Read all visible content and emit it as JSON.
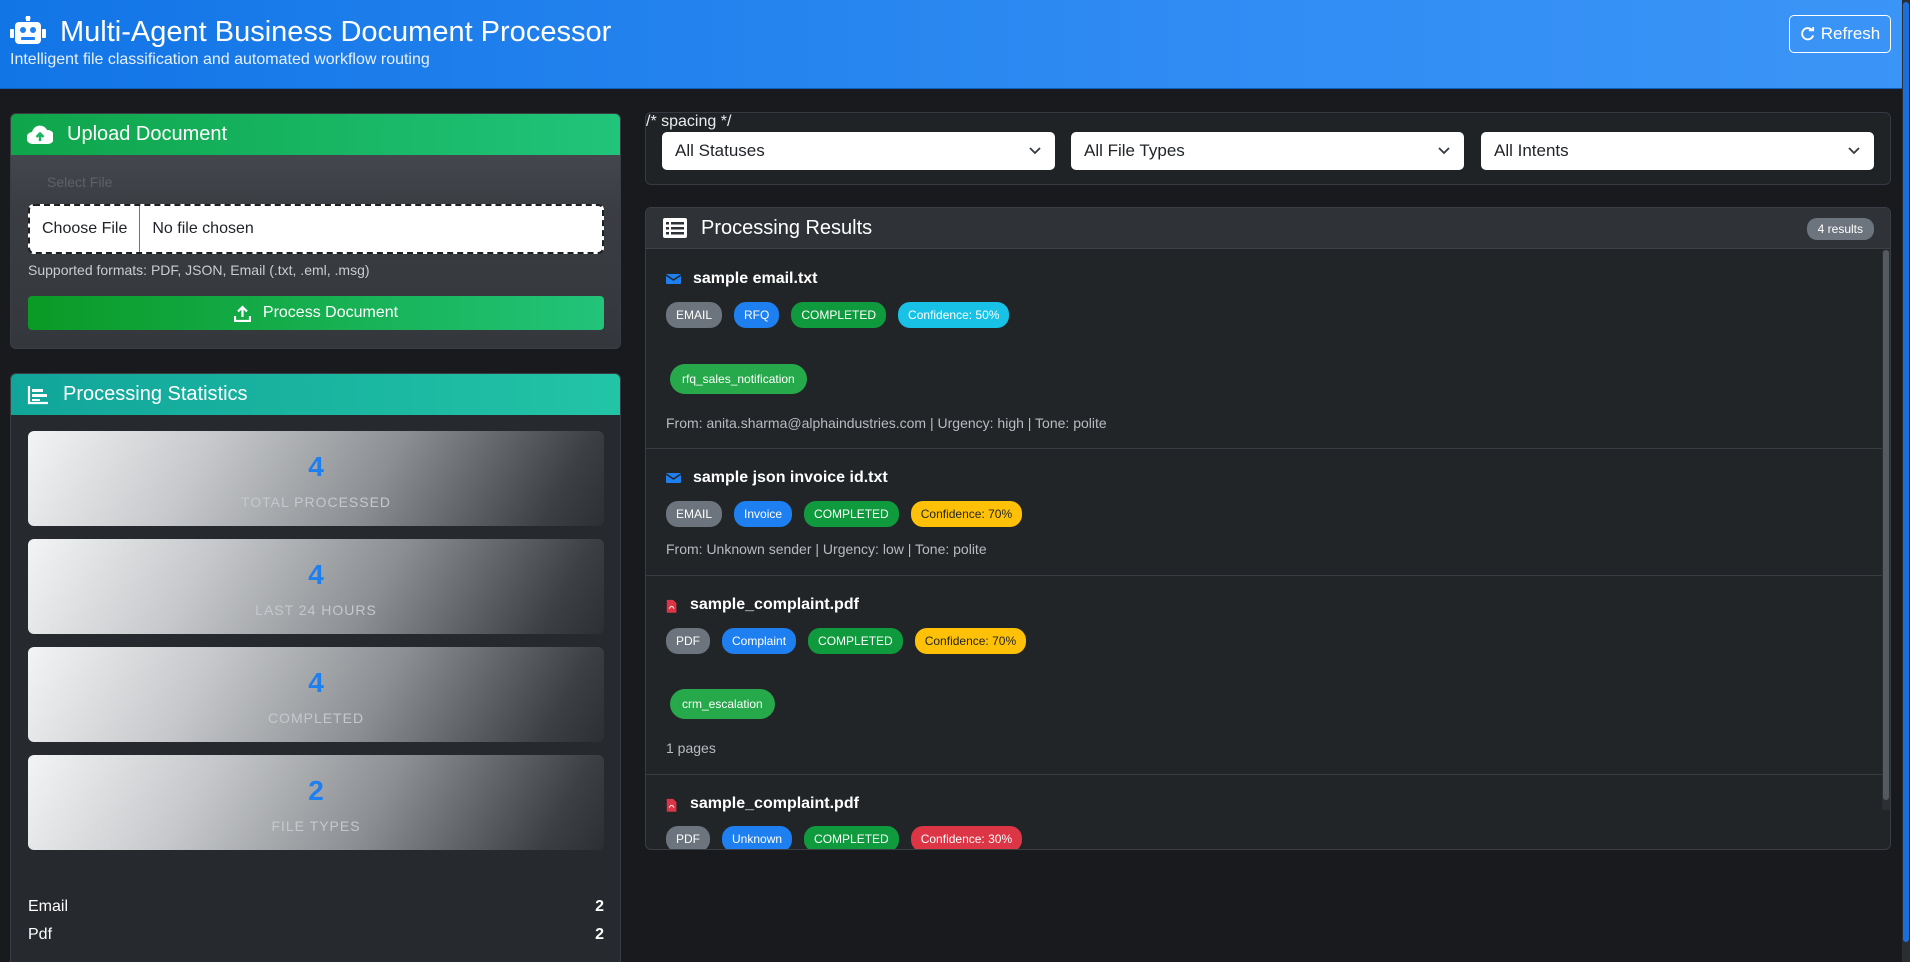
{
  "header": {
    "title": "Multi-Agent Business Document Processor",
    "subtitle": "Intelligent file classification and automated workflow routing",
    "refresh_label": "Refresh",
    "icon": "robot-icon"
  },
  "upload": {
    "title": "Upload Document",
    "choose_label": "Select File",
    "file_button": "Choose File",
    "file_status": "No file chosen",
    "formats": "Supported formats: PDF, JSON, Email (.txt, .eml, .msg)",
    "process_label": "Process Document"
  },
  "stats": {
    "title": "Processing Statistics",
    "boxes": [
      {
        "value": "4",
        "label": "Total Processed"
      },
      {
        "value": "4",
        "label": "Last 24 Hours"
      },
      {
        "value": "4",
        "label": "Completed"
      },
      {
        "value": "2",
        "label": "File Types"
      }
    ],
    "types": [
      {
        "name": "Email",
        "count": "2"
      },
      {
        "name": "Pdf",
        "count": "2"
      }
    ]
  },
  "filters": {
    "status": "All Statuses",
    "file_type": "All File Types",
    "intent": "All Intents"
  },
  "results": {
    "title": "Processing Results",
    "count": "4 results",
    "items": [
      {
        "name": "sample email.txt",
        "icon": "envelope-icon",
        "badges": [
          "EMAIL",
          "RFQ",
          "COMPLETED",
          "Confidence: 50%"
        ],
        "route": "rfq_sales_notification",
        "meta": "From: anita.sharma@alphaindustries.com | Urgency: high | Tone: polite"
      },
      {
        "name": "sample json invoice id.txt",
        "icon": "envelope-icon",
        "badges": [
          "EMAIL",
          "Invoice",
          "COMPLETED",
          "Confidence: 70%"
        ],
        "meta": "From: Unknown sender | Urgency: low | Tone: polite"
      },
      {
        "name": "sample_complaint.pdf",
        "icon": "pdf-file-icon",
        "badges": [
          "PDF",
          "Complaint",
          "COMPLETED",
          "Confidence: 70%"
        ],
        "route": "crm_escalation",
        "meta": "1 pages"
      },
      {
        "name": "sample_complaint.pdf",
        "icon": "pdf-file-icon",
        "badges": [
          "PDF",
          "Unknown",
          "COMPLETED",
          "Confidence: 30%"
        ]
      }
    ]
  },
  "colors": {
    "header": "#1f80ef",
    "upload_head": "#16b45f",
    "stats_head": "#16b4a0",
    "accent_blue": "#1d7ff0",
    "success": "#0f9b3d",
    "warning": "#ffc107",
    "danger": "#dc3545",
    "info": "#17c2e6"
  }
}
